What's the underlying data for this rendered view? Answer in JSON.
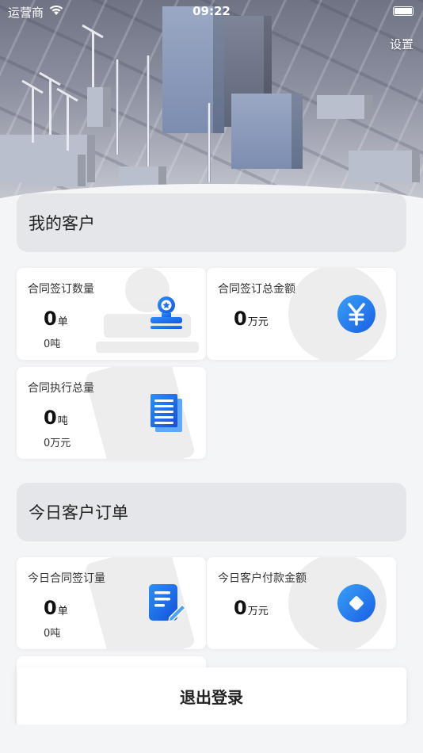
{
  "status_bar": {
    "carrier": "运营商",
    "time": "09:22"
  },
  "header": {
    "settings_label": "设置"
  },
  "my_customers": {
    "title": "我的客户",
    "cards": [
      {
        "title": "合同签订数量",
        "value": "0",
        "unit": "单",
        "sub": "0吨",
        "icon": "stamp-icon"
      },
      {
        "title": "合同签订总金额",
        "value": "0",
        "unit": "万元",
        "sub": "",
        "icon": "yen-icon"
      },
      {
        "title": "合同执行总量",
        "value": "0",
        "unit": "吨",
        "sub": "0万元",
        "icon": "document-icon"
      }
    ]
  },
  "today_orders": {
    "title": "今日客户订单",
    "cards": [
      {
        "title": "今日合同签订量",
        "value": "0",
        "unit": "单",
        "sub": "0吨",
        "icon": "edit-document-icon"
      },
      {
        "title": "今日客户付款金额",
        "value": "0",
        "unit": "万元",
        "sub": "",
        "icon": "coin-icon"
      }
    ]
  },
  "logout_label": "退出登录",
  "colors": {
    "accent_blue": "#1f73f0",
    "section_bg": "#e4e6ea",
    "page_bg": "#f4f5f7"
  }
}
